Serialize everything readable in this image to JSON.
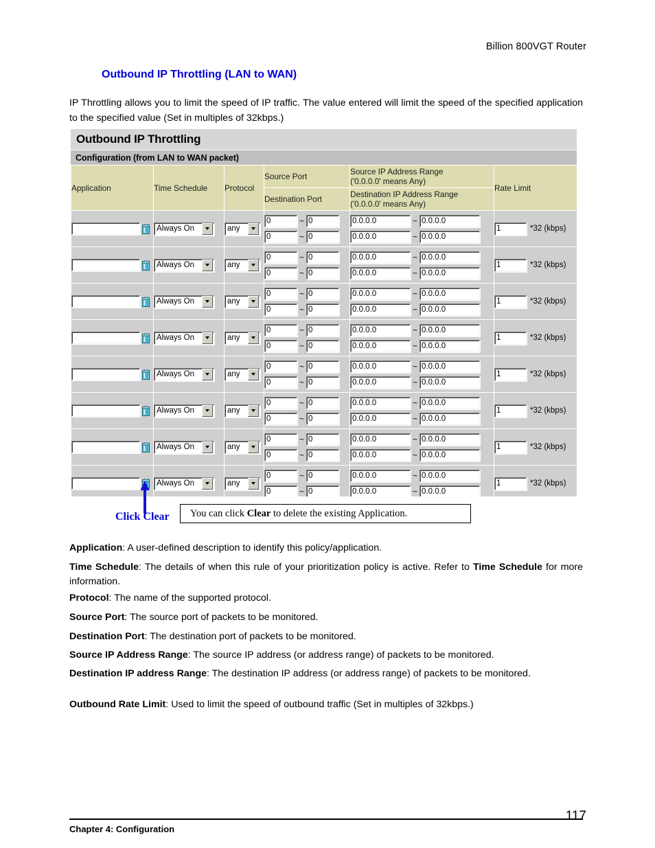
{
  "document": {
    "running_header": "Billion 800VGT Router",
    "section_title": "Outbound IP Throttling (LAN to WAN)",
    "intro": "IP Throttling allows you to limit the speed of IP traffic. The value entered will limit the speed of the specified application to the specified value (Set in multiples of 32kbps.)",
    "footer_chapter": "Chapter 4: Configuration",
    "page_number": "117"
  },
  "panel": {
    "title": "Outbound IP Throttling",
    "subtitle": "Configuration (from LAN to WAN packet)",
    "headers": {
      "application": "Application",
      "time_schedule": "Time Schedule",
      "protocol": "Protocol",
      "source_port": "Source Port",
      "destination_port": "Destination Port",
      "source_ip_range_line1": "Source IP Address Range",
      "source_ip_range_line2": "('0.0.0.0' means Any)",
      "destination_ip_range_line1": "Destination IP Address Range",
      "destination_ip_range_line2": "('0.0.0.0' means Any)",
      "rate_limit": "Rate Limit"
    },
    "row_defaults": {
      "application_value": "",
      "application_placeholder": "",
      "time_schedule_value": "Always On",
      "protocol_value": "any",
      "source_port_from": "0",
      "source_port_to": "0",
      "destination_port_from": "0",
      "destination_port_to": "0",
      "source_ip_from": "0.0.0.0",
      "source_ip_to": "0.0.0.0",
      "destination_ip_from": "0.0.0.0",
      "destination_ip_to": "0.0.0.0",
      "range_separator": "~",
      "rate_limit_value": "1",
      "rate_limit_unit": "*32 (kbps)",
      "clear_icon": "trash-can-icon"
    },
    "row_count": 8
  },
  "callout": {
    "label": "Click Clear",
    "text_prefix": "You can click ",
    "text_bold": "Clear",
    "text_suffix": " to delete the existing Application.",
    "arrow_color": "#1414d2",
    "label_color": "#0000cc"
  },
  "descriptions": [
    {
      "term": "Application",
      "sep": ": ",
      "body": "A user-defined description to identify this policy/application."
    },
    {
      "term": "Time Schedule",
      "sep": ": ",
      "body": "The details of when this rule of your prioritization policy is active. Refer to ",
      "body_bold": "Time Schedule",
      "body_tail": " for more information."
    },
    {
      "term": "Protocol",
      "sep": ": ",
      "body": "The name of the supported protocol."
    },
    {
      "term": "Source Port",
      "sep": ": ",
      "body": "The source port of packets to be monitored."
    },
    {
      "term": "Destination Port",
      "sep": ": ",
      "body": "The destination port of packets to be monitored."
    },
    {
      "term": "Source IP Address Range",
      "sep": ": ",
      "body": "The source IP address (or address range) of packets to be monitored."
    },
    {
      "term": "Destination IP address Range",
      "sep": ": ",
      "body": "The destination IP address (or address range) of packets to be monitored."
    },
    {
      "term": "Outbound Rate Limit",
      "sep": ": ",
      "body": "Used to limit the speed of outbound traffic (Set in multiples of 32kbps.)"
    }
  ],
  "colors": {
    "heading": "#0000d8",
    "panel_title_bg": "#d6d6d6",
    "panel_subtitle_bg": "#bfbfbf",
    "table_header_bg": "#dcdcb0",
    "table_body_bg": "#cfcfcf",
    "trash_icon": "#56c8e6"
  }
}
